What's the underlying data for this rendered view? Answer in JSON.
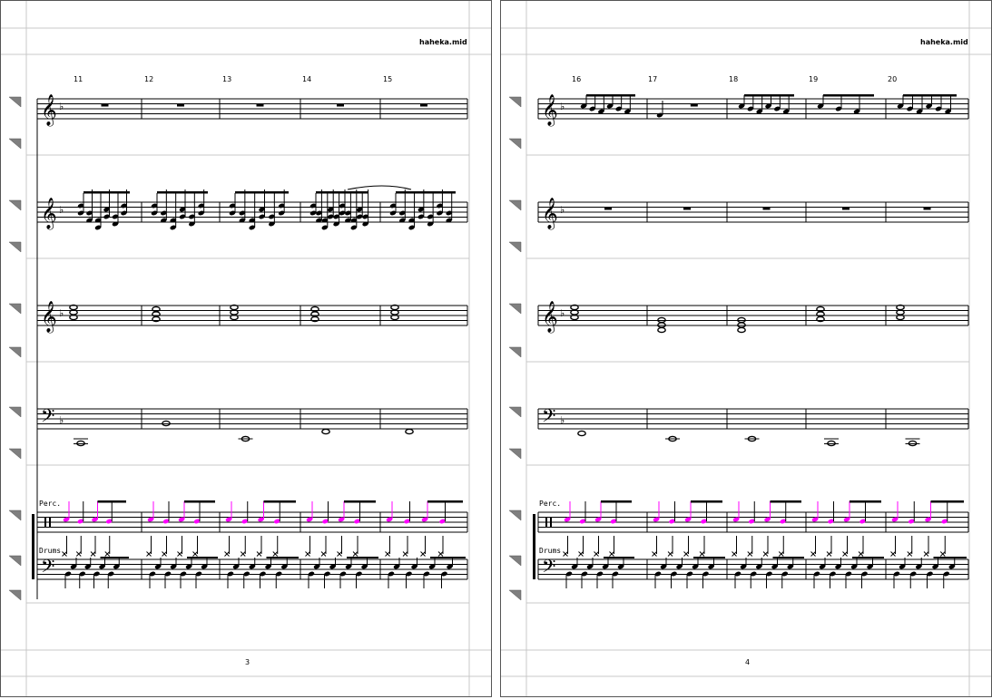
{
  "colors": {
    "guide": "#c8c8c8",
    "ink": "#000000",
    "percussion": "#ff00ff",
    "handle": "#7f7f7f"
  },
  "pages": [
    {
      "filename": "haheka.mid",
      "page_number": "3",
      "measures": [
        "11",
        "12",
        "13",
        "14",
        "15"
      ],
      "perc_label": "Perc.",
      "drums_label": "Drums"
    },
    {
      "filename": "haheka.mid",
      "page_number": "4",
      "measures": [
        "16",
        "17",
        "18",
        "19",
        "20"
      ],
      "perc_label": "Perc.",
      "drums_label": "Drums"
    }
  ],
  "staff_handle_icon": "triangle-handle-icon"
}
